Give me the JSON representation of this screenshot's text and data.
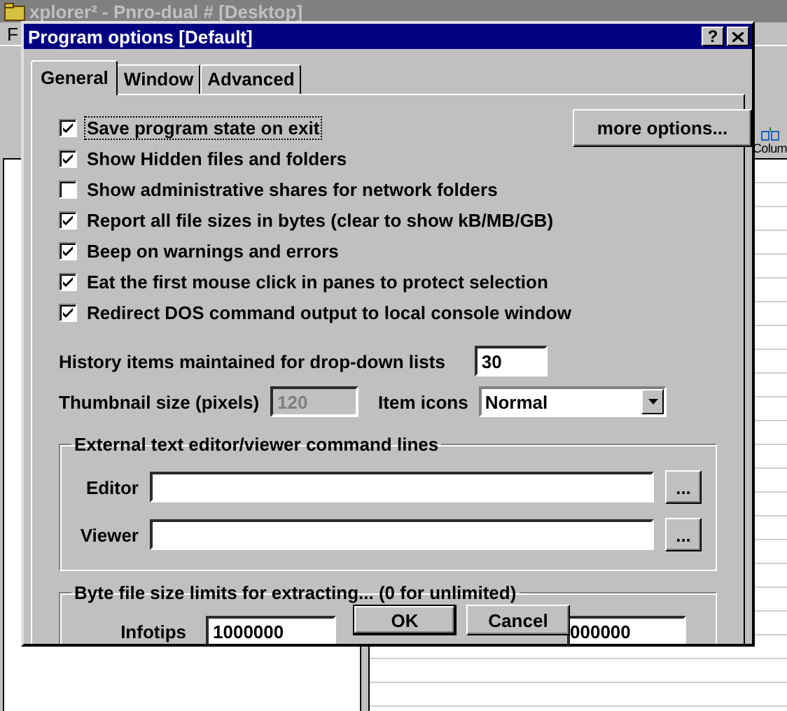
{
  "background_window": {
    "title": "xplorer² - Pnro-dual # [Desktop]",
    "menu": [
      "F"
    ],
    "toolbar_label": "Colum"
  },
  "dialog": {
    "title": "Program options [Default]",
    "help": "?"
  },
  "tabs": [
    {
      "label": "General",
      "selected": true
    },
    {
      "label": "Window",
      "selected": false
    },
    {
      "label": "Advanced",
      "selected": false
    }
  ],
  "options": [
    {
      "label": "Save program state on exit",
      "checked": true,
      "focused": true
    },
    {
      "label": "Show Hidden files and folders",
      "checked": true,
      "focused": false
    },
    {
      "label": "Show administrative shares for network folders",
      "checked": false,
      "focused": false
    },
    {
      "label": "Report all file sizes in bytes (clear to show kB/MB/GB)",
      "checked": true,
      "focused": false
    },
    {
      "label": "Beep on warnings and errors",
      "checked": true,
      "focused": false
    },
    {
      "label": "Eat the first mouse click in panes to protect selection",
      "checked": true,
      "focused": false
    },
    {
      "label": "Redirect DOS command output to local console window",
      "checked": true,
      "focused": false
    }
  ],
  "more_options_button": "more options...",
  "history": {
    "label": "History items maintained for drop-down lists",
    "value": "30"
  },
  "thumbnail": {
    "label": "Thumbnail size (pixels)",
    "value": "120",
    "disabled": true
  },
  "item_icons": {
    "label": "Item icons",
    "value": "Normal"
  },
  "editor_group": {
    "title": "External text editor/viewer command lines",
    "rows": [
      {
        "label": "Editor",
        "button": "..."
      },
      {
        "label": "Viewer",
        "button": "..."
      }
    ]
  },
  "limits_group": {
    "title": "Byte file size limits for extracting... (0 for unlimited)",
    "label": "Infotips",
    "values": [
      "1000000",
      "000000"
    ]
  },
  "buttons": [
    {
      "label": "OK",
      "default": true
    },
    {
      "label": "Cancel",
      "default": false
    }
  ]
}
